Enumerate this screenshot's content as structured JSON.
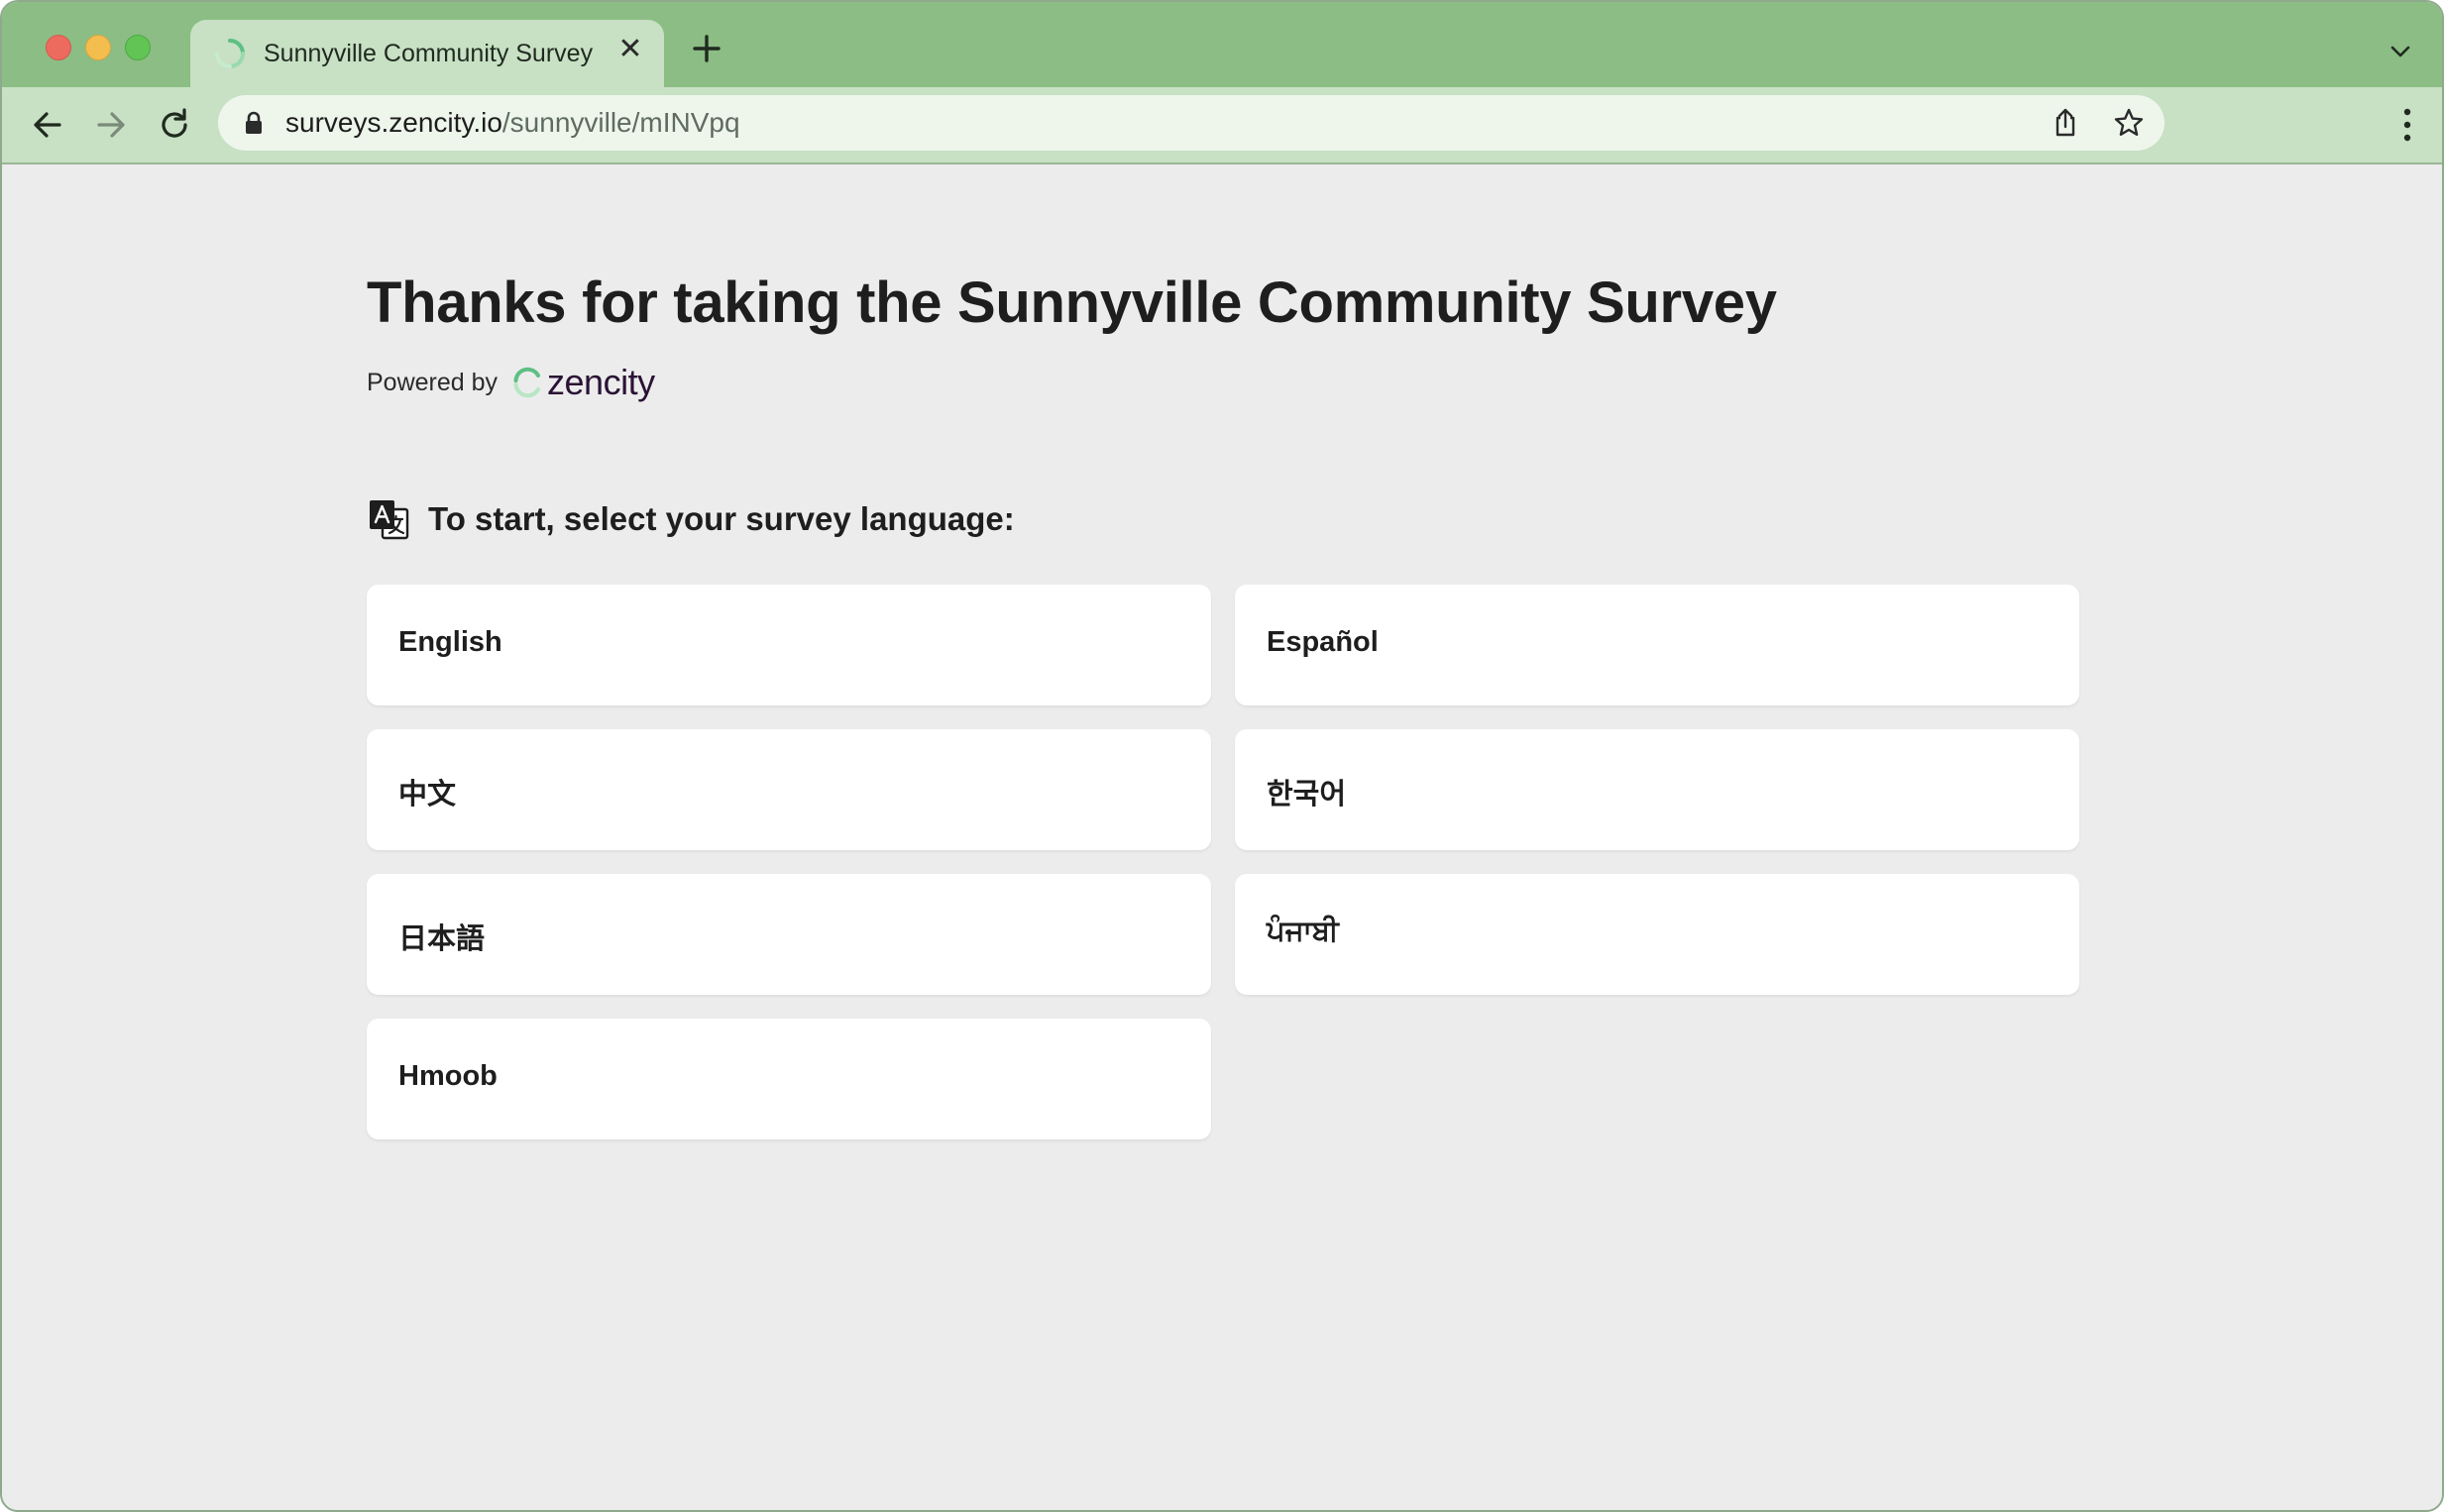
{
  "browser": {
    "tab": {
      "title": "Sunnyville Community Survey",
      "close_glyph": "✕"
    },
    "address_bar": {
      "domain": "surveys.zencity.io",
      "path": "/sunnyville/mINVpq"
    }
  },
  "page": {
    "headline": "Thanks for taking the Sunnyville Community Survey",
    "powered_by": {
      "label": "Powered by",
      "brand": "zencity"
    },
    "prompt": "To start, select your survey language:",
    "languages": [
      {
        "label": "English"
      },
      {
        "label": "Español"
      },
      {
        "label": "中文"
      },
      {
        "label": "한국어"
      },
      {
        "label": "日本語"
      },
      {
        "label": "ਪੰਜਾਬੀ"
      },
      {
        "label": "Hmoob"
      }
    ]
  },
  "colors": {
    "tabstrip": "#8bbd84",
    "toolbar": "#c8e0c4",
    "page_background": "#ececec",
    "card_background": "#ffffff",
    "brand_text": "#2a1235",
    "brand_accent": "#7fcf9a"
  },
  "icons": {
    "favicon": "zencity-spinner-icon",
    "new_tab": "plus-icon",
    "tab_menu": "chevron-down-icon",
    "back": "arrow-left-icon",
    "forward": "arrow-right-icon",
    "reload": "reload-icon",
    "lock": "lock-icon",
    "share": "share-icon",
    "bookmark": "star-icon",
    "menu": "kebab-menu-icon",
    "translate": "translate-icon"
  }
}
